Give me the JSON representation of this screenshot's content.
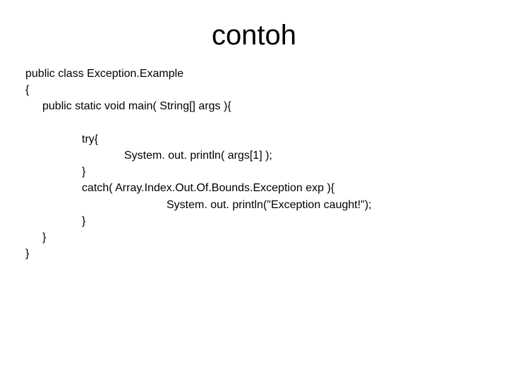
{
  "title": "contoh",
  "code": {
    "line1": "public class Exception.Example",
    "line2": "{",
    "line3": "public static void main( String[] args ){",
    "line4": "try{",
    "line5": "System. out. println( args[1] );",
    "line6": "}",
    "line7": "catch( Array.Index.Out.Of.Bounds.Exception exp ){",
    "line8": "System. out. println(\"Exception caught!\");",
    "line9": "}",
    "line10": "}",
    "line11": "}"
  }
}
